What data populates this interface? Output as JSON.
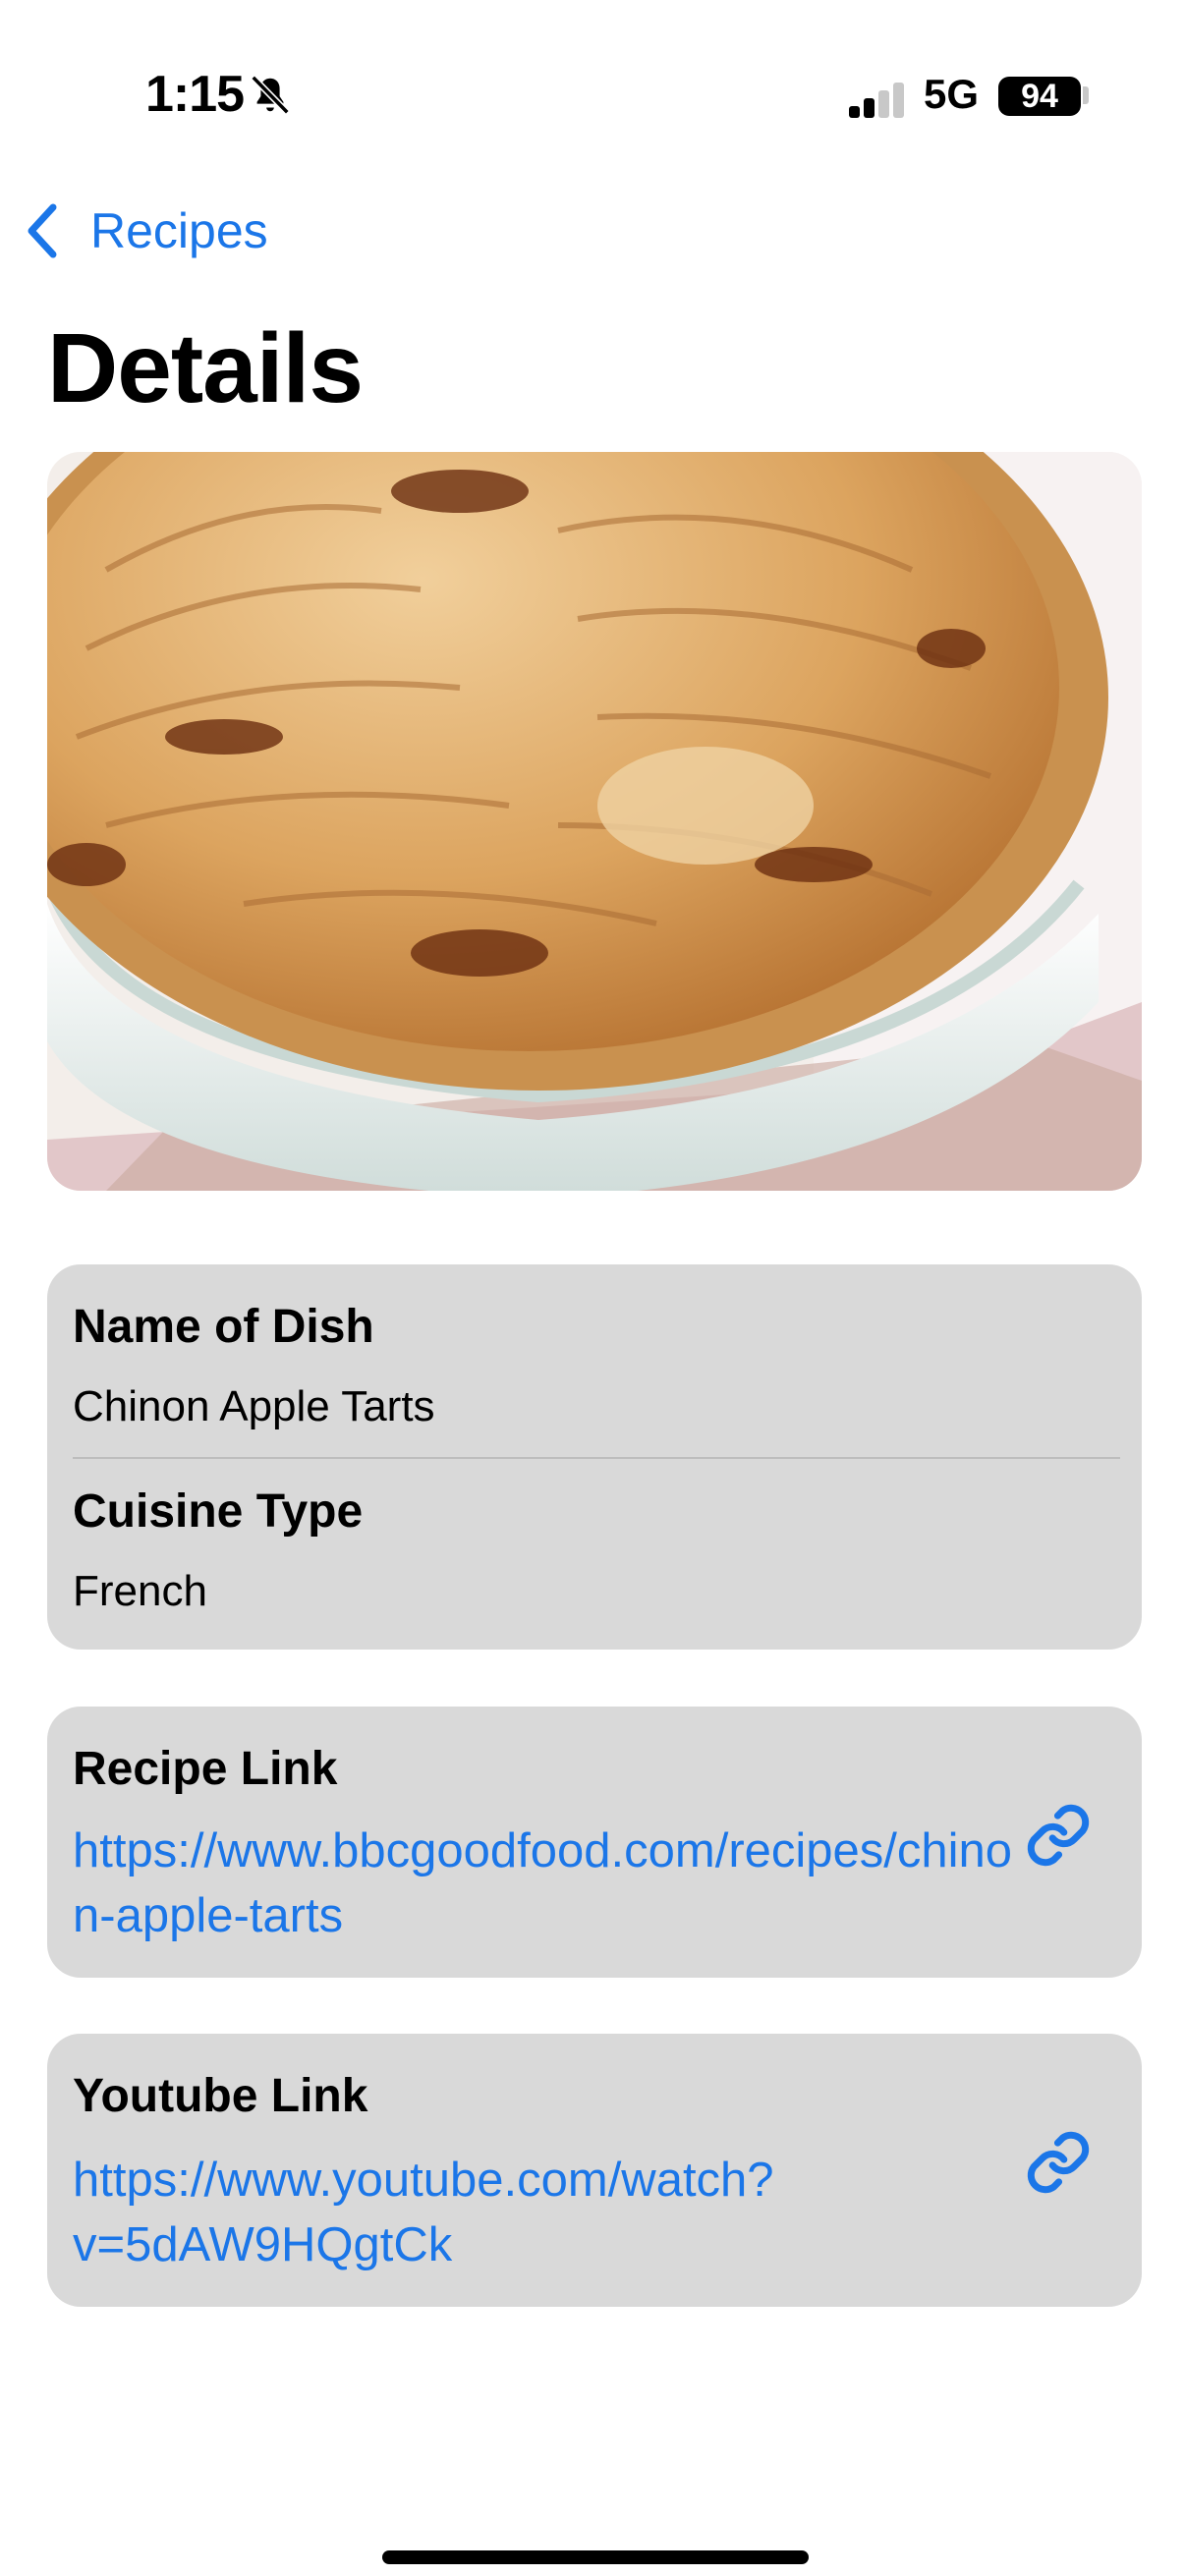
{
  "status": {
    "time": "1:15",
    "network": "5G",
    "battery": "94"
  },
  "nav": {
    "back_label": "Recipes",
    "title": "Details"
  },
  "details": {
    "name_label": "Name of Dish",
    "name_value": "Chinon Apple Tarts",
    "cuisine_label": "Cuisine Type",
    "cuisine_value": "French"
  },
  "recipe": {
    "label": "Recipe Link",
    "url": "https://www.bbcgoodfood.com/recipes/chinon-apple-tarts"
  },
  "youtube": {
    "label": "Youtube Link",
    "url": "https://www.youtube.com/watch?v=5dAW9HQgtCk"
  },
  "colors": {
    "accent": "#1b76e8",
    "card": "#d9d9d9"
  },
  "icons": [
    "bell-slash-icon",
    "signal-icon",
    "chevron-left-icon",
    "link-icon"
  ]
}
